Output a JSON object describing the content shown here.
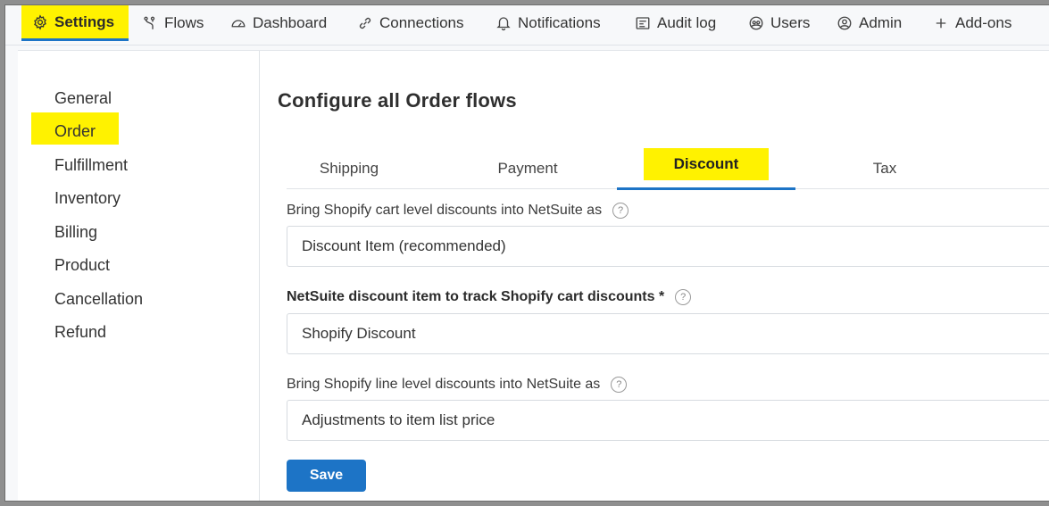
{
  "nav": {
    "items": [
      {
        "label": "Settings",
        "icon": "gear-icon",
        "active": true
      },
      {
        "label": "Flows",
        "icon": "flows-icon"
      },
      {
        "label": "Dashboard",
        "icon": "gauge-icon"
      },
      {
        "label": "Connections",
        "icon": "link-icon"
      },
      {
        "label": "Notifications",
        "icon": "bell-icon"
      },
      {
        "label": "Audit log",
        "icon": "audit-log-icon"
      },
      {
        "label": "Users",
        "icon": "users-icon"
      },
      {
        "label": "Admin",
        "icon": "admin-user-icon"
      },
      {
        "label": "Add-ons",
        "icon": "plus-icon"
      }
    ]
  },
  "sidebar": {
    "items": [
      {
        "label": "General"
      },
      {
        "label": "Order",
        "active": true
      },
      {
        "label": "Fulfillment"
      },
      {
        "label": "Inventory"
      },
      {
        "label": "Billing"
      },
      {
        "label": "Product"
      },
      {
        "label": "Cancellation"
      },
      {
        "label": "Refund"
      }
    ]
  },
  "main": {
    "title": "Configure all Order flows",
    "tabs": [
      {
        "label": "Shipping"
      },
      {
        "label": "Payment"
      },
      {
        "label": "Discount",
        "active": true
      },
      {
        "label": "Tax"
      }
    ],
    "fields": [
      {
        "label": "Bring Shopify cart level discounts into NetSuite as",
        "value": "Discount Item (recommended)",
        "help": "?"
      },
      {
        "label": "NetSuite discount item to track Shopify cart discounts *",
        "value": "Shopify Discount",
        "help": "?"
      },
      {
        "label": "Bring Shopify line level discounts into NetSuite as",
        "value": "Adjustments to item list price",
        "help": "?"
      }
    ],
    "save_label": "Save"
  },
  "colors": {
    "highlight": "#fff200",
    "accent": "#1d74c6"
  }
}
